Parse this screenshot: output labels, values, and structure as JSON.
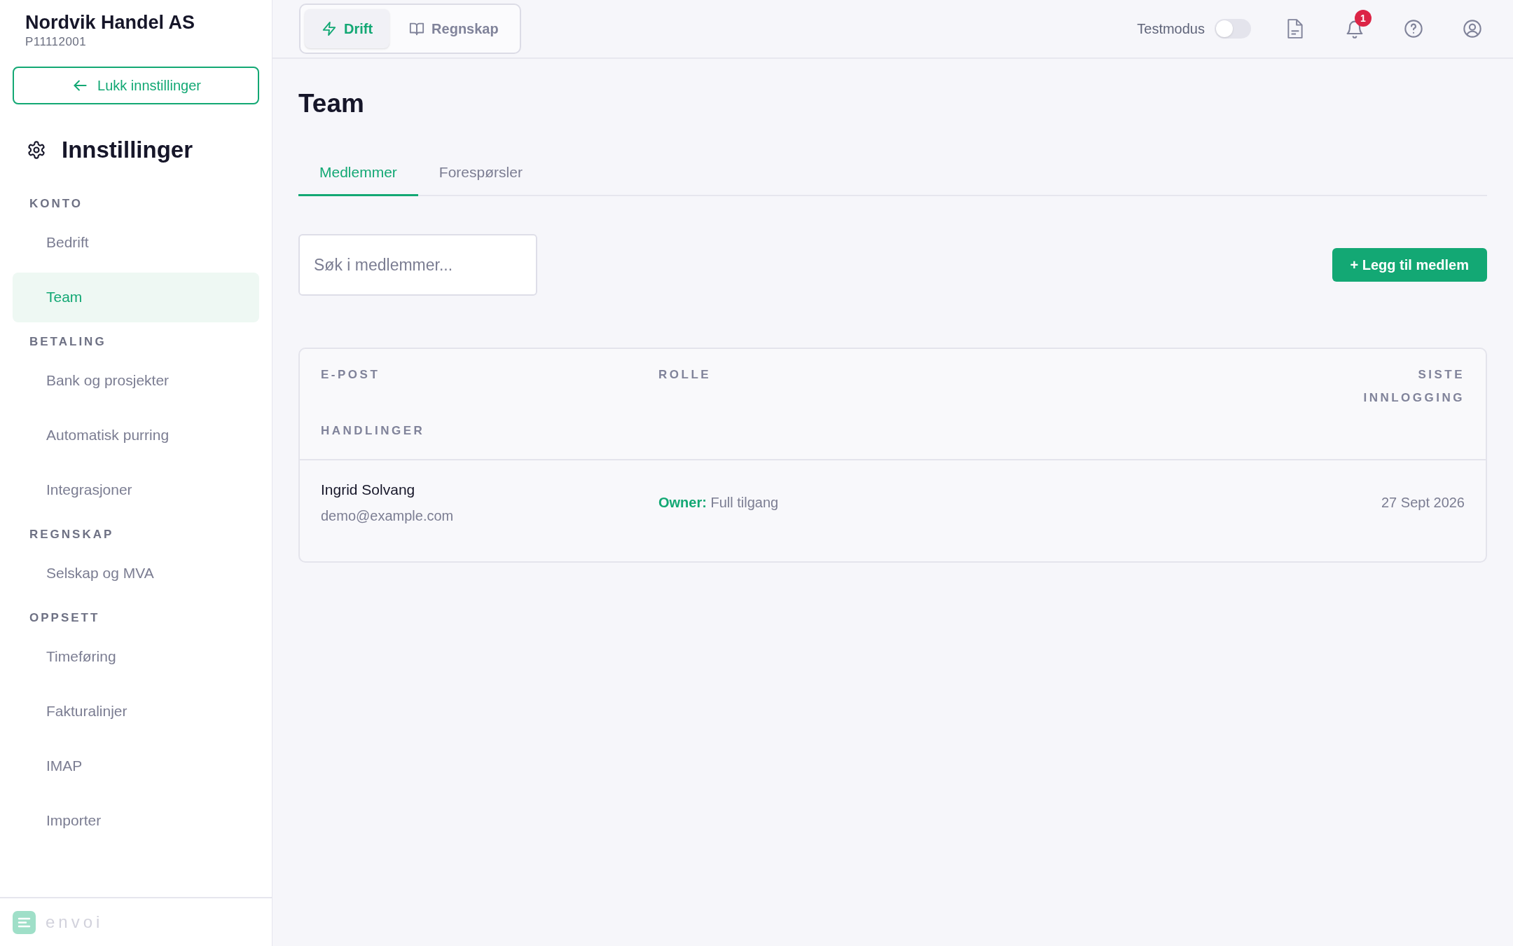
{
  "company": {
    "name": "Nordvik Handel AS",
    "id": "P11112001"
  },
  "close_button": "Lukk innstillinger",
  "sidebar": {
    "title": "Innstillinger",
    "sections": [
      {
        "label": "KONTO",
        "items": [
          {
            "label": "Bedrift",
            "selected": false
          },
          {
            "label": "Team",
            "selected": true
          }
        ]
      },
      {
        "label": "BETALING",
        "items": [
          {
            "label": "Bank og prosjekter",
            "selected": false
          },
          {
            "label": "Automatisk purring",
            "selected": false
          },
          {
            "label": "Integrasjoner",
            "selected": false
          }
        ]
      },
      {
        "label": "REGNSKAP",
        "items": [
          {
            "label": "Selskap og MVA",
            "selected": false
          }
        ]
      },
      {
        "label": "OPPSETT",
        "items": [
          {
            "label": "Timeføring",
            "selected": false
          },
          {
            "label": "Fakturalinjer",
            "selected": false
          },
          {
            "label": "IMAP",
            "selected": false
          },
          {
            "label": "Importer",
            "selected": false
          }
        ]
      }
    ]
  },
  "footer": {
    "brand": "envoi"
  },
  "modes": [
    {
      "label": "Drift",
      "kind": "bolt",
      "selected": true
    },
    {
      "label": "Regnskap",
      "kind": "book",
      "selected": false
    }
  ],
  "test_mode": {
    "label": "Testmodus",
    "on": false
  },
  "notifications": {
    "count": "1"
  },
  "page": {
    "title": "Team"
  },
  "tabs": [
    {
      "label": "Medlemmer",
      "selected": true
    },
    {
      "label": "Forespørsler",
      "selected": false
    }
  ],
  "search": {
    "placeholder": "Søk i medlemmer..."
  },
  "add_button": "+ Legg til medlem",
  "table": {
    "columns": [
      "E-POST",
      "ROLLE",
      "SISTE INNLOGGING",
      "HANDLINGER"
    ],
    "rows": [
      {
        "name": "Ingrid Solvang",
        "email": "demo@example.com",
        "role": "Owner:",
        "access": "Full tilgang",
        "last_login": "27 Sept 2026"
      }
    ]
  }
}
